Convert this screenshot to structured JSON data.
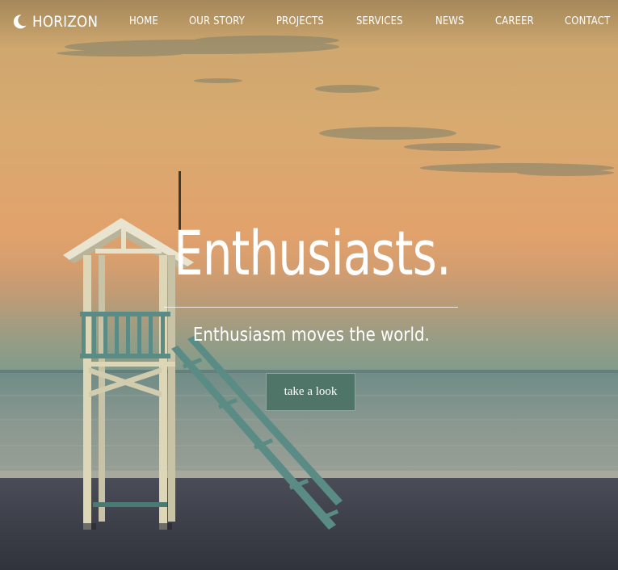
{
  "brand": {
    "name": "HORIZON",
    "icon": "crescent-moon-icon"
  },
  "nav": {
    "items": [
      {
        "label": "HOME"
      },
      {
        "label": "OUR STORY"
      },
      {
        "label": "PROJECTS"
      },
      {
        "label": "SERVICES"
      },
      {
        "label": "NEWS"
      },
      {
        "label": "CAREER"
      },
      {
        "label": "CONTACT"
      }
    ]
  },
  "hero": {
    "title": "Enthusiasts.",
    "subtitle": "Enthusiasm moves the world.",
    "cta_label": "take a look",
    "background": "beach-lifeguard-tower-at-sunset-photo"
  },
  "colors": {
    "nav_text": "#ffffff",
    "cta_background": "#4f7569",
    "sky_top": "#c9a56e",
    "sky_bottom": "#e3a06c",
    "sea": "#8a9b92",
    "sand": "#3b3e4a"
  }
}
